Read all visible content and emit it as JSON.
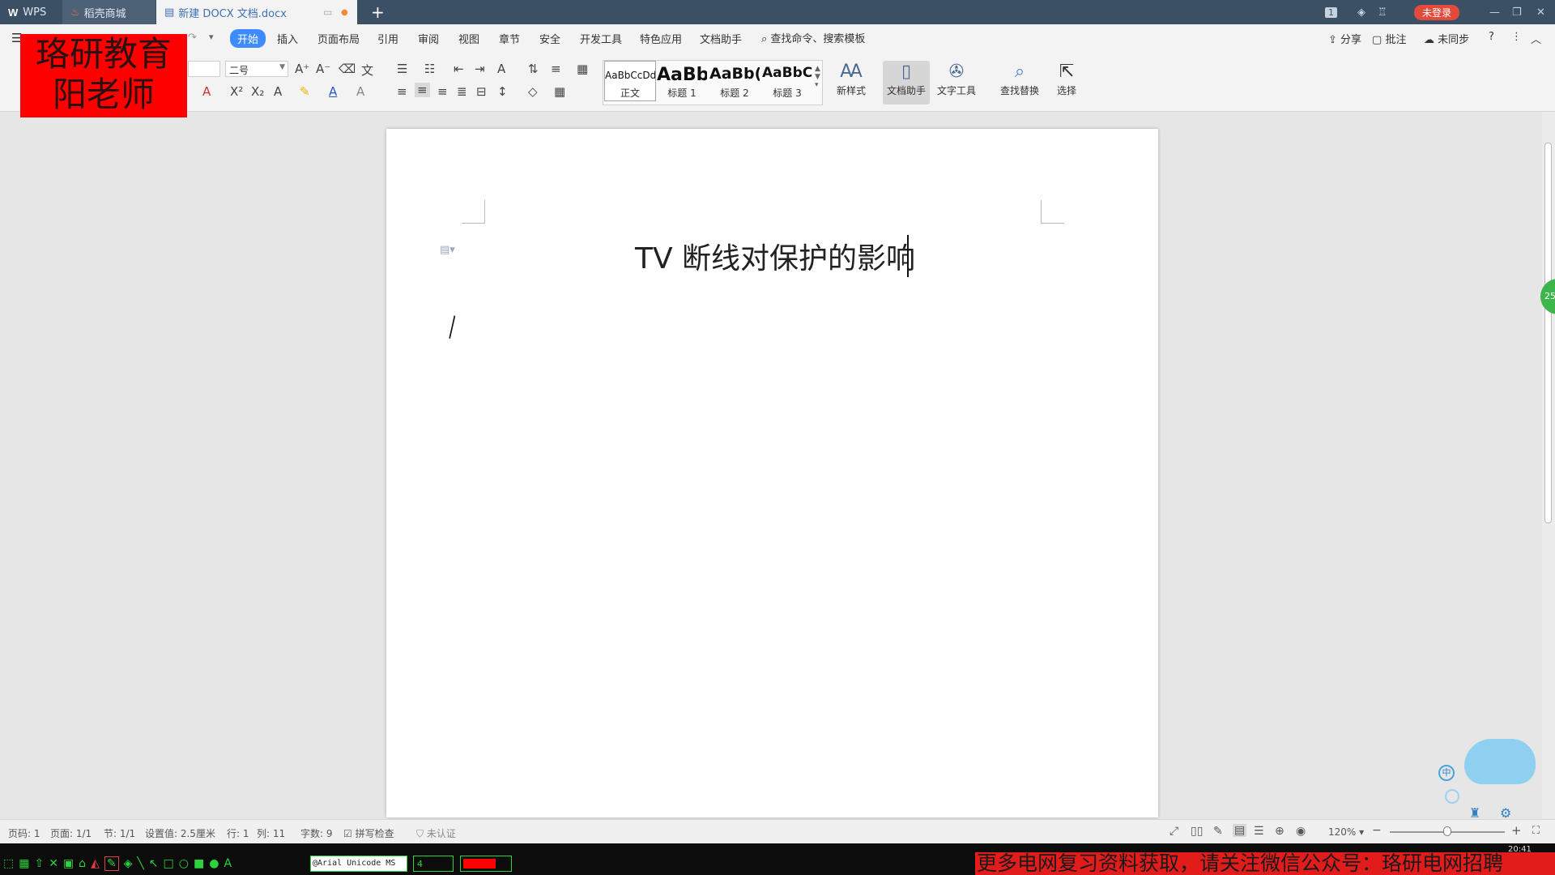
{
  "tabs": {
    "wps": "WPS",
    "store": "稻壳商城",
    "document": "新建 DOCX 文档.docx"
  },
  "titlebar": {
    "page_count_badge": "1",
    "login_badge": "未登录"
  },
  "menu": {
    "items": [
      "开始",
      "插入",
      "页面布局",
      "引用",
      "审阅",
      "视图",
      "章节",
      "安全",
      "开发工具",
      "特色应用",
      "文档助手"
    ],
    "search_placeholder": "查找命令、搜索模板",
    "share": "分享",
    "comment": "批注",
    "sync": "未同步"
  },
  "ribbon": {
    "font_size": "二号",
    "styles": [
      {
        "preview": "AaBbCcDd",
        "name": "正文"
      },
      {
        "preview": "AaBb",
        "name": "标题 1"
      },
      {
        "preview": "AaBb(",
        "name": "标题 2"
      },
      {
        "preview": "AaBbC(",
        "name": "标题 3"
      }
    ],
    "new_style": "新样式",
    "doc_assistant": "文档助手",
    "text_tools": "文字工具",
    "find_replace": "查找替换",
    "select": "选择"
  },
  "document": {
    "title": "TV 断线对保护的影响"
  },
  "statusbar": {
    "page_num": "页码: 1",
    "pages": "页面: 1/1",
    "section": "节: 1/1",
    "setting": "设置值: 2.5厘米",
    "row": "行: 1",
    "col": "列: 11",
    "word_count": "字数: 9",
    "spell_check": "拼写检查",
    "certification": "未认证",
    "zoom": "120%"
  },
  "overlay": {
    "watermark_line1": "珞研教育",
    "watermark_line2": "阳老师",
    "banner": "更多电网复习资料获取，请关注微信公众号：珞研电网招聘",
    "font_box": "@Arial Unicode MS",
    "size_box": "4",
    "clock": "20:41",
    "side_badge": "25"
  },
  "colors": {
    "titlebar": "#3b4f65",
    "accent": "#3d8bff",
    "banner": "#e21b1b",
    "watermark": "#ff0000"
  }
}
